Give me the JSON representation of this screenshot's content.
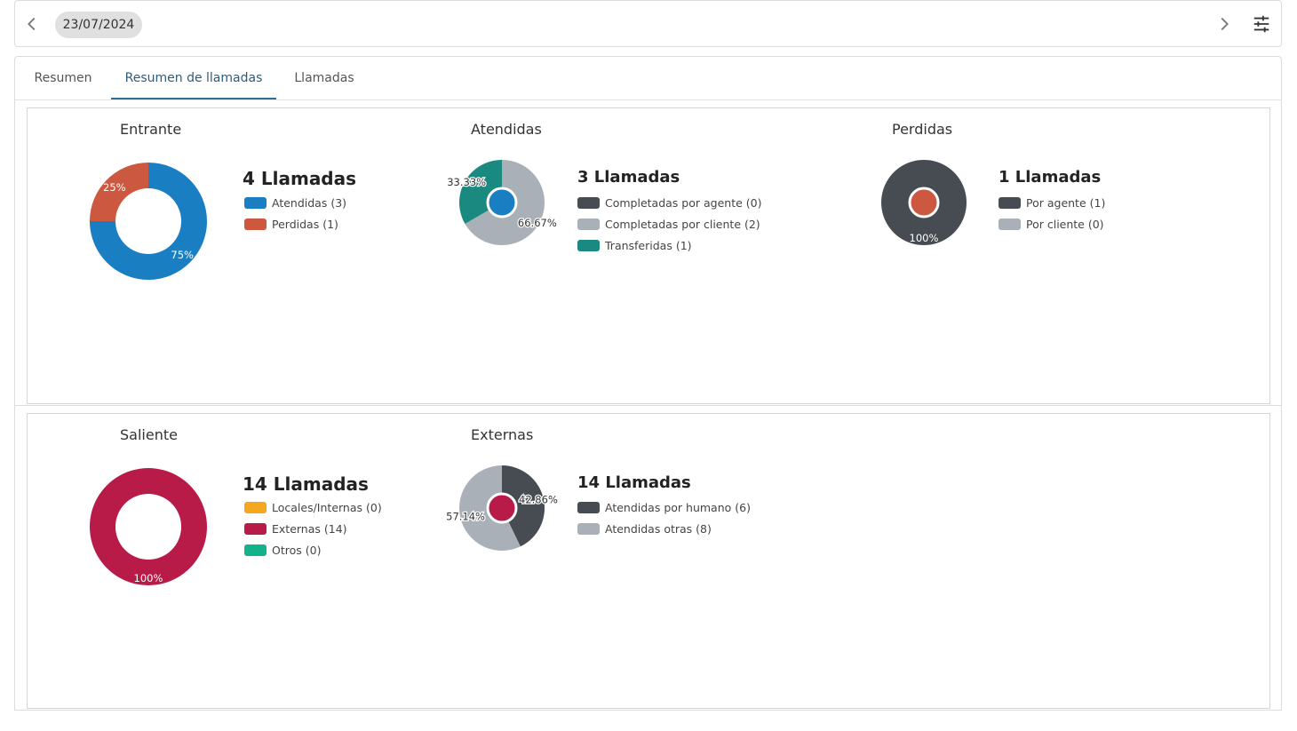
{
  "header": {
    "date": "23/07/2024"
  },
  "tabs": [
    {
      "label": "Resumen"
    },
    {
      "label": "Resumen de llamadas"
    },
    {
      "label": "Llamadas"
    }
  ],
  "icons": {
    "prev": "chevron-left-icon",
    "next": "chevron-right-icon",
    "filter": "tune-sliders-icon"
  },
  "chart_data": [
    {
      "type": "pie",
      "title": "Entrante",
      "total_label": "4 Llamadas",
      "categories": [
        "Atendidas (3)",
        "Perdidas (1)"
      ],
      "values": [
        3,
        1
      ],
      "percent_labels": [
        "75%",
        "25%"
      ],
      "colors": [
        "#1a7fc2",
        "#cc5840"
      ],
      "legend": "right"
    },
    {
      "type": "pie",
      "title": "Atendidas",
      "total_label": "3 Llamadas",
      "categories": [
        "Completadas por agente (0)",
        "Completadas por cliente (2)",
        "Transferidas (1)"
      ],
      "values": [
        0,
        2,
        1
      ],
      "percent_labels": [
        "",
        "66.67%",
        "33.33%"
      ],
      "colors": [
        "#474b52",
        "#aab0b7",
        "#1a8a80"
      ],
      "center_color": "#1a7fc2",
      "legend": "right"
    },
    {
      "type": "pie",
      "title": "Perdidas",
      "total_label": "1 Llamadas",
      "categories": [
        "Por agente (1)",
        "Por cliente (0)"
      ],
      "values": [
        1,
        0
      ],
      "percent_labels": [
        "100%",
        ""
      ],
      "colors": [
        "#474b52",
        "#aab0b7"
      ],
      "center_color": "#cc5840",
      "legend": "right"
    },
    {
      "type": "pie",
      "title": "Saliente",
      "total_label": "14 Llamadas",
      "categories": [
        "Locales/Internas (0)",
        "Externas (14)",
        "Otros (0)"
      ],
      "values": [
        0,
        14,
        0
      ],
      "percent_labels": [
        "",
        "100%",
        ""
      ],
      "colors": [
        "#f3a81f",
        "#b81b48",
        "#12b28a"
      ],
      "legend": "right"
    },
    {
      "type": "pie",
      "title": "Externas",
      "total_label": "14 Llamadas",
      "categories": [
        "Atendidas por humano (6)",
        "Atendidas otras (8)"
      ],
      "values": [
        6,
        8
      ],
      "percent_labels": [
        "42.86%",
        "57.14%"
      ],
      "colors": [
        "#474b52",
        "#aab0b7"
      ],
      "center_color": "#b81b48",
      "legend": "right"
    }
  ]
}
